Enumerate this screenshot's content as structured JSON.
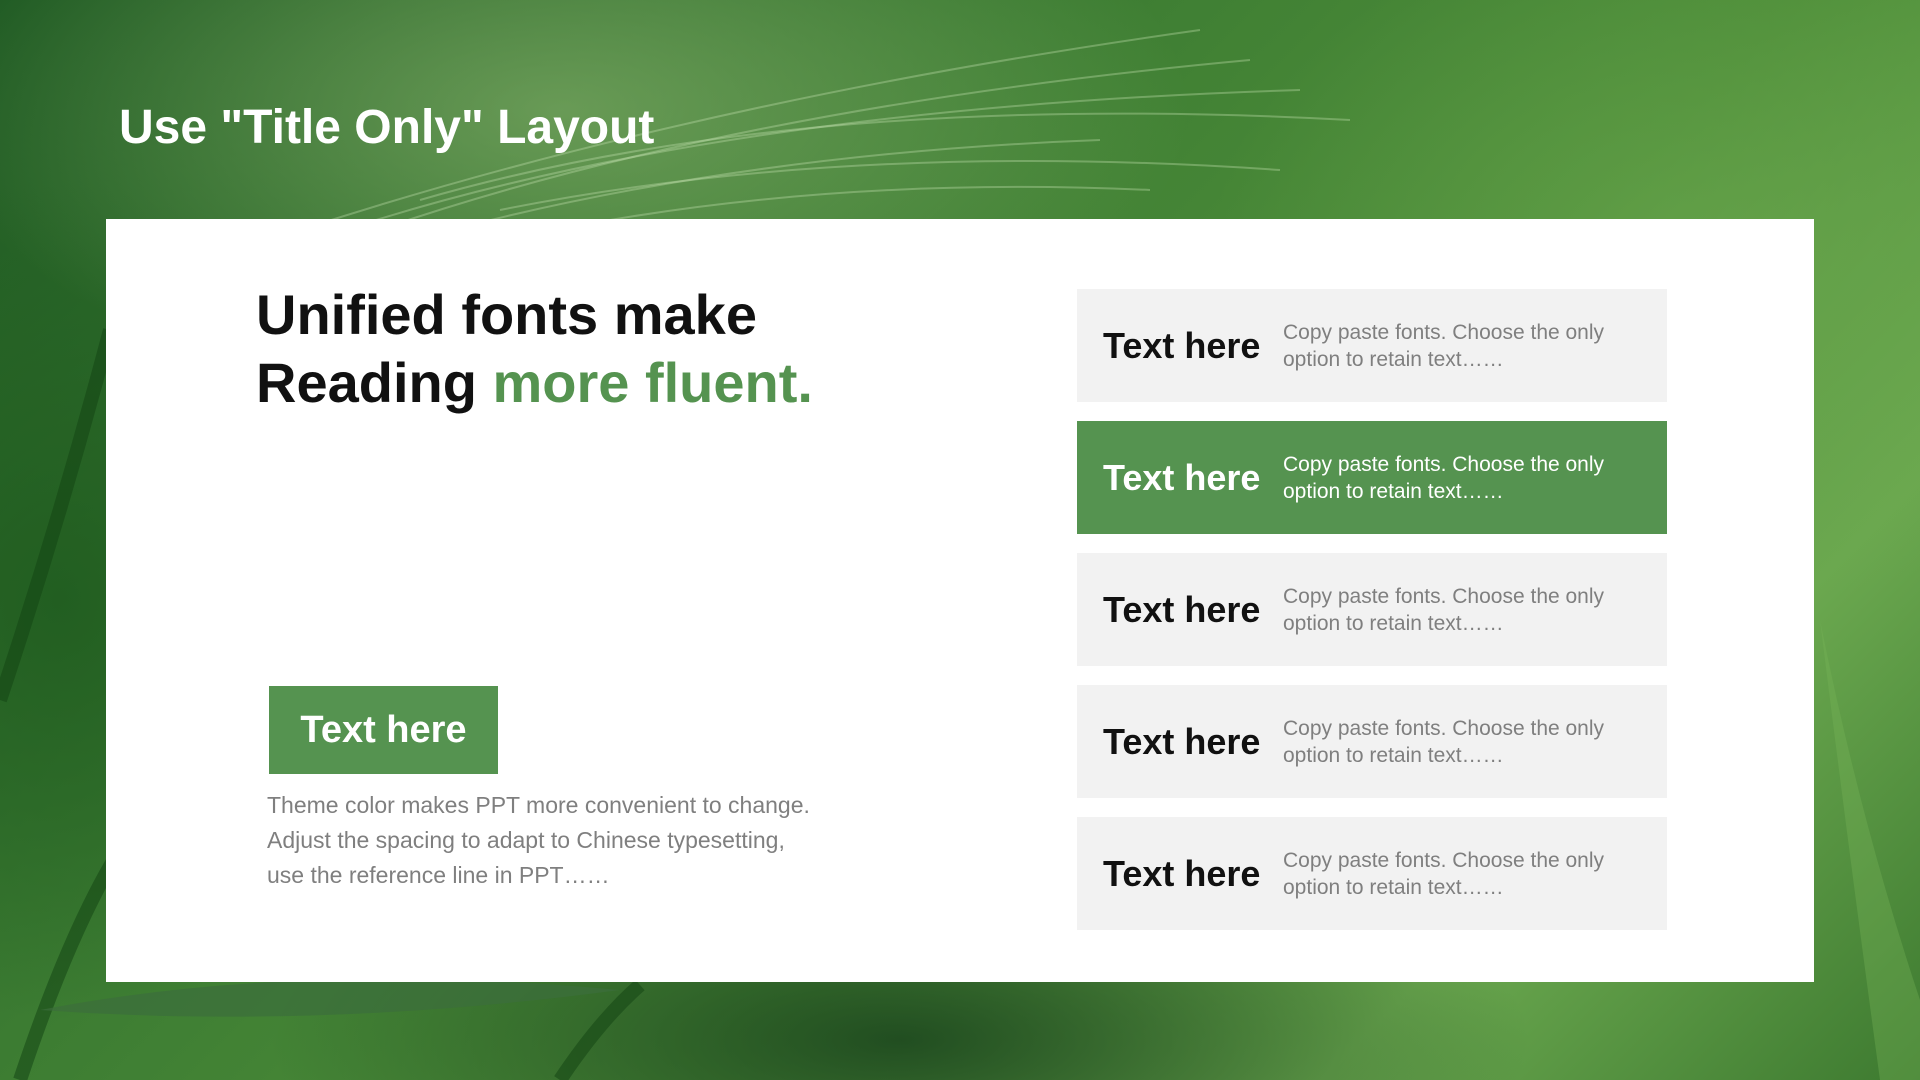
{
  "slide": {
    "title": "Use \"Title Only\" Layout"
  },
  "headline": {
    "line1": "Unified fonts make",
    "line2_prefix": "Reading ",
    "line2_accent": "more fluent."
  },
  "cta": {
    "label": "Text here"
  },
  "description": {
    "para1": "Theme color makes PPT more convenient to change.",
    "para2": "Adjust the spacing to adapt to Chinese typesetting, use the reference line in PPT……"
  },
  "list": {
    "items": [
      {
        "title": "Text here",
        "text": "Copy paste fonts. Choose the only option to retain text……",
        "active": false
      },
      {
        "title": "Text here",
        "text": "Copy paste fonts. Choose the only option to retain text……",
        "active": true
      },
      {
        "title": "Text here",
        "text": "Copy paste fonts. Choose the only option to retain text……",
        "active": false
      },
      {
        "title": "Text here",
        "text": "Copy paste fonts. Choose the only option to retain text……",
        "active": false
      },
      {
        "title": "Text here",
        "text": "Copy paste fonts. Choose the only option to retain text……",
        "active": false
      }
    ]
  },
  "colors": {
    "accent": "#559350",
    "item_bg": "#f2f2f2",
    "body_text": "#7f7f7f"
  }
}
